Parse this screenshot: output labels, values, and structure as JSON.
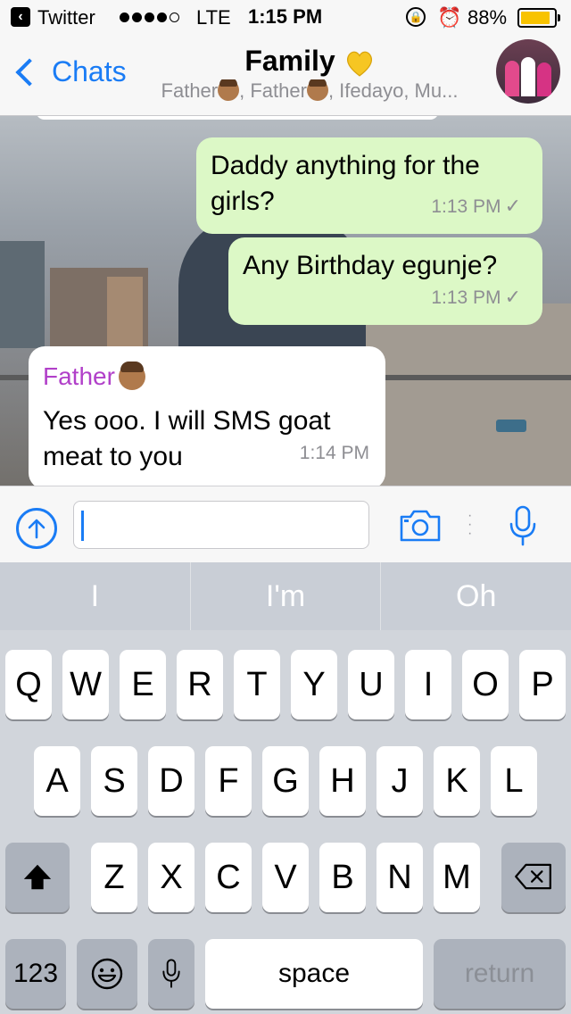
{
  "status_bar": {
    "back_app": "Twitter",
    "network": "LTE",
    "time": "1:15 PM",
    "battery": "88%",
    "battery_level": 0.88
  },
  "nav": {
    "back_label": "Chats",
    "title": "Family",
    "subtitle_prefix": "Father",
    "subtitle_mid": ", Father",
    "subtitle_suffix": ", Ifedayo, Mu..."
  },
  "messages": [
    {
      "direction": "out",
      "line1": "Daddy anything for the",
      "line2": "girls?",
      "time": "1:13 PM"
    },
    {
      "direction": "out",
      "line1": "Any Birthday egunje?",
      "time": "1:13 PM"
    },
    {
      "direction": "in",
      "sender": "Father",
      "line1": "Yes ooo. I will SMS goat",
      "line2": "meat to you",
      "time": "1:14 PM"
    }
  ],
  "suggestions": [
    "I",
    "I'm",
    "Oh"
  ],
  "keys": {
    "row1": [
      "Q",
      "W",
      "E",
      "R",
      "T",
      "Y",
      "U",
      "I",
      "O",
      "P"
    ],
    "row2": [
      "A",
      "S",
      "D",
      "F",
      "G",
      "H",
      "J",
      "K",
      "L"
    ],
    "row3": [
      "Z",
      "X",
      "C",
      "V",
      "B",
      "N",
      "M"
    ],
    "numbers": "123",
    "space": "space",
    "return": "return"
  },
  "colors": {
    "accent": "#1a7cf5",
    "outgoing_bubble": "#dcf8c6",
    "sender_name": "#b140c9",
    "battery": "#f8c300"
  }
}
